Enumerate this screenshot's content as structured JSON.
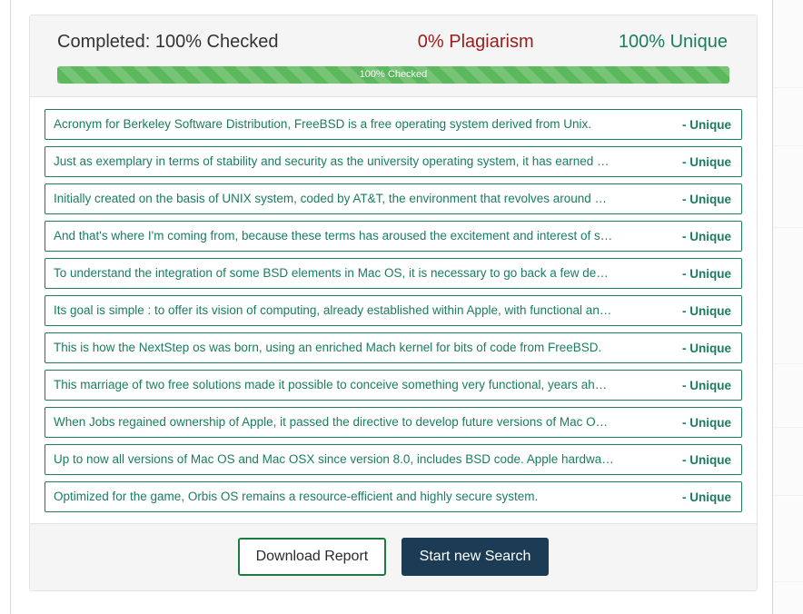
{
  "header": {
    "completed_label": "Completed: 100% Checked",
    "plagiarism_label": "0% Plagiarism",
    "unique_label": "100% Unique",
    "progress_label": "100% Checked",
    "progress_percent": 100,
    "colors": {
      "plagiarism": "#9b1c1c",
      "unique": "#1a7d5f",
      "progress_bar": "#5cb85c",
      "panel_heading_bg": "#f5f5f5"
    }
  },
  "results": [
    {
      "text": "Acronym for Berkeley Software Distribution, FreeBSD is a free operating system derived from Unix.",
      "status": "- Unique"
    },
    {
      "text": "Just as exemplary in terms of stability and security as the university operating system, it has earned …",
      "status": "- Unique"
    },
    {
      "text": "Initially created on the basis of UNIX system, coded by AT&T, the environment that revolves around …",
      "status": "- Unique"
    },
    {
      "text": "And that's where I'm coming from, because these terms has aroused the excitement and interest of s…",
      "status": "- Unique"
    },
    {
      "text": "To understand the integration of some BSD elements in Mac OS, it is necessary to go back a few de…",
      "status": "- Unique"
    },
    {
      "text": "Its goal is simple : to offer its vision of computing, already established within Apple, with functional an…",
      "status": "- Unique"
    },
    {
      "text": "This is how the NextStep os was born, using an enriched Mach kernel for bits of code from FreeBSD.",
      "status": "- Unique"
    },
    {
      "text": "This marriage of two free solutions made it possible to conceive something very functional, years ah…",
      "status": "- Unique"
    },
    {
      "text": "When Jobs regained ownership of Apple, it passed the directive to develop future versions of Mac O…",
      "status": "- Unique"
    },
    {
      "text": "Up to now all versions of Mac OS and Mac OSX since version 8.0, includes BSD code. Apple hardwa…",
      "status": "- Unique"
    },
    {
      "text": "Optimized for the game, Orbis OS remains a resource-efficient and highly secure system.",
      "status": "- Unique"
    }
  ],
  "footer": {
    "download_label": "Download Report",
    "new_search_label": "Start new Search",
    "colors": {
      "download_border": "#1a7d3f",
      "new_search_bg": "#1b3c54"
    }
  }
}
